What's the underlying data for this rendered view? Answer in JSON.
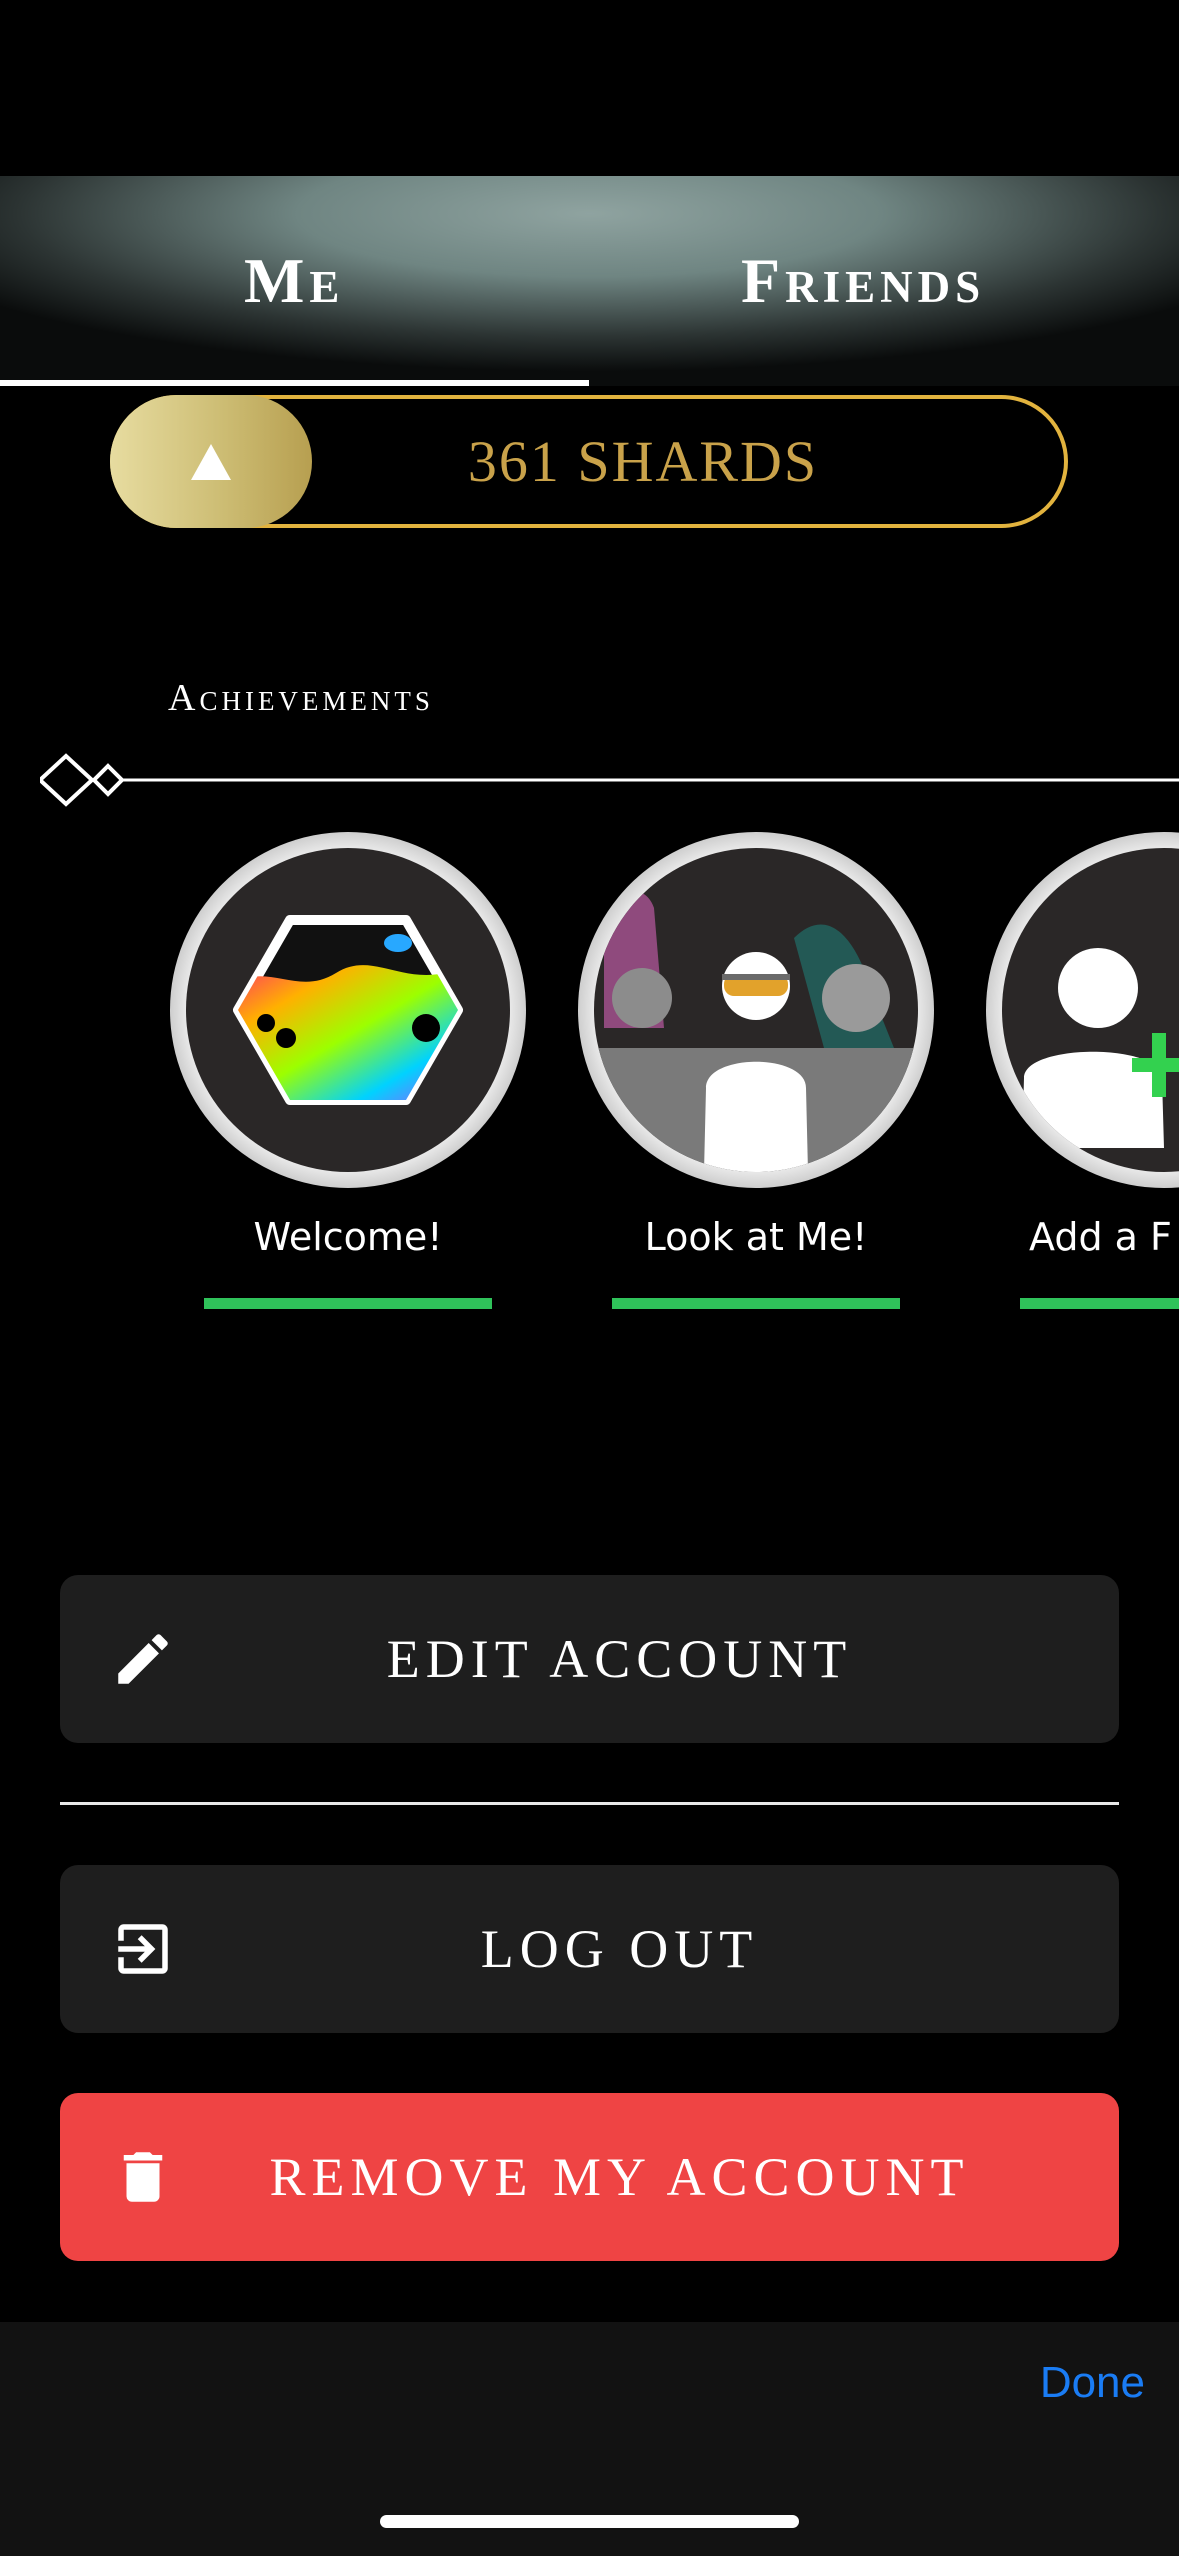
{
  "tabs": [
    {
      "label": "Me",
      "active": true
    },
    {
      "label": "Friends",
      "active": false
    }
  ],
  "shards": {
    "count_label": "361 SHARDS"
  },
  "achievements": {
    "title": "Achievements",
    "items": [
      {
        "label": "Welcome!",
        "icon": "paint-hexagon-icon",
        "progress": 1.0
      },
      {
        "label": "Look at Me!",
        "icon": "avatar-group-icon",
        "progress": 1.0
      },
      {
        "label": "Add a F",
        "icon": "add-friend-icon",
        "progress": 1.0
      }
    ]
  },
  "actions": {
    "edit_account": "EDIT ACCOUNT",
    "log_out": "LOG OUT",
    "remove_account": "REMOVE MY ACCOUNT"
  },
  "toolbar": {
    "done_label": "Done"
  },
  "colors": {
    "accent_gold": "#e2b33e",
    "progress_green": "#2fc25a",
    "danger_red": "#ef4444",
    "link_blue": "#1a7cf4"
  }
}
